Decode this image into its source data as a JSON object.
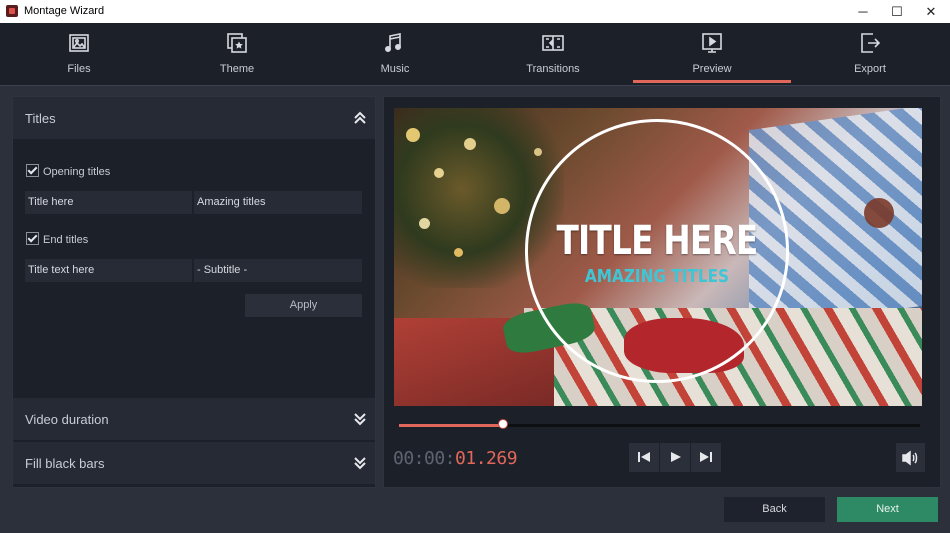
{
  "window": {
    "title": "Montage Wizard",
    "minimize": "─",
    "maximize": "☐",
    "close": "✕"
  },
  "tabs": [
    {
      "label": "Files",
      "icon": "files-icon"
    },
    {
      "label": "Theme",
      "icon": "theme-icon"
    },
    {
      "label": "Music",
      "icon": "music-icon"
    },
    {
      "label": "Transitions",
      "icon": "transitions-icon"
    },
    {
      "label": "Preview",
      "icon": "preview-icon",
      "active": true
    },
    {
      "label": "Export",
      "icon": "export-icon"
    }
  ],
  "titles_section": {
    "heading": "Titles",
    "opening_titles": {
      "label": "Opening titles",
      "checked": true,
      "title": "Title here",
      "subtitle": "Amazing titles"
    },
    "end_titles": {
      "label": "End titles",
      "checked": true,
      "title": "Title text here",
      "subtitle": "- Subtitle -"
    },
    "apply_label": "Apply"
  },
  "video_duration": {
    "heading": "Video duration"
  },
  "fill_black_bars": {
    "heading": "Fill black bars"
  },
  "preview": {
    "title_text": "TITLE HERE",
    "subtitle_text": "AMAZING TITLES",
    "progress_fraction": 0.2
  },
  "timecode": {
    "prefix": "00:00:",
    "value": "01.269"
  },
  "footer": {
    "back_label": "Back",
    "next_label": "Next"
  },
  "colors": {
    "accent": "#e0675a",
    "next_button": "#2d8a64",
    "subtitle_cyan": "#3ec6d6"
  }
}
